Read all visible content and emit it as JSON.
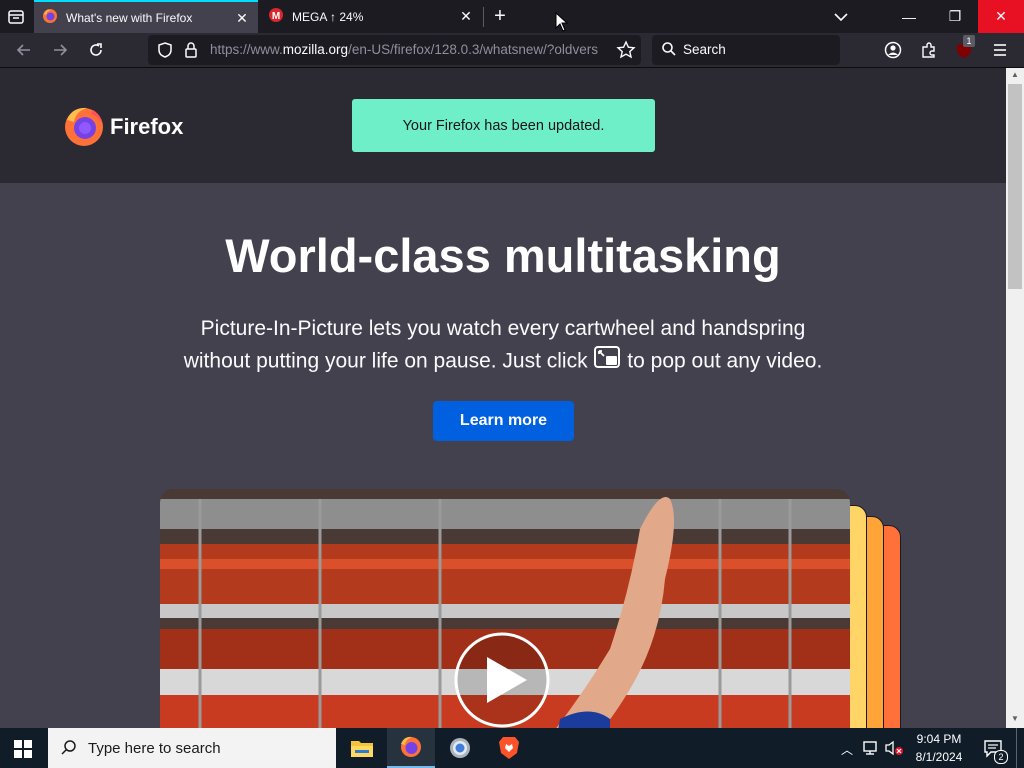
{
  "tabs": [
    {
      "title": "What's new with Firefox",
      "active": true
    },
    {
      "title": "MEGA ↑ 24%",
      "active": false
    }
  ],
  "window": {
    "minimize": "—",
    "restore": "❐",
    "close": "✕"
  },
  "navbar": {
    "url_prefix": "https://www.",
    "url_domain": "mozilla.org",
    "url_rest": "/en-US/firefox/128.0.3/whatsnew/?oldvers",
    "search_placeholder": "Search",
    "extension_badge": "1"
  },
  "page": {
    "brand": "Firefox",
    "notice": "Your Firefox has been updated.",
    "headline": "World-class multitasking",
    "paragraph_line1": "Picture-In-Picture lets you watch every cartwheel and handspring",
    "paragraph_line2a": "without putting your life on pause. Just click",
    "paragraph_line2b": "to pop out any video.",
    "cta": "Learn more"
  },
  "taskbar": {
    "search_placeholder": "Type here to search",
    "time": "9:04 PM",
    "date": "8/1/2024",
    "notification_count": "2"
  },
  "colors": {
    "accent": "#0060df",
    "notice_bg": "#6fefc7",
    "close_red": "#e81123"
  }
}
